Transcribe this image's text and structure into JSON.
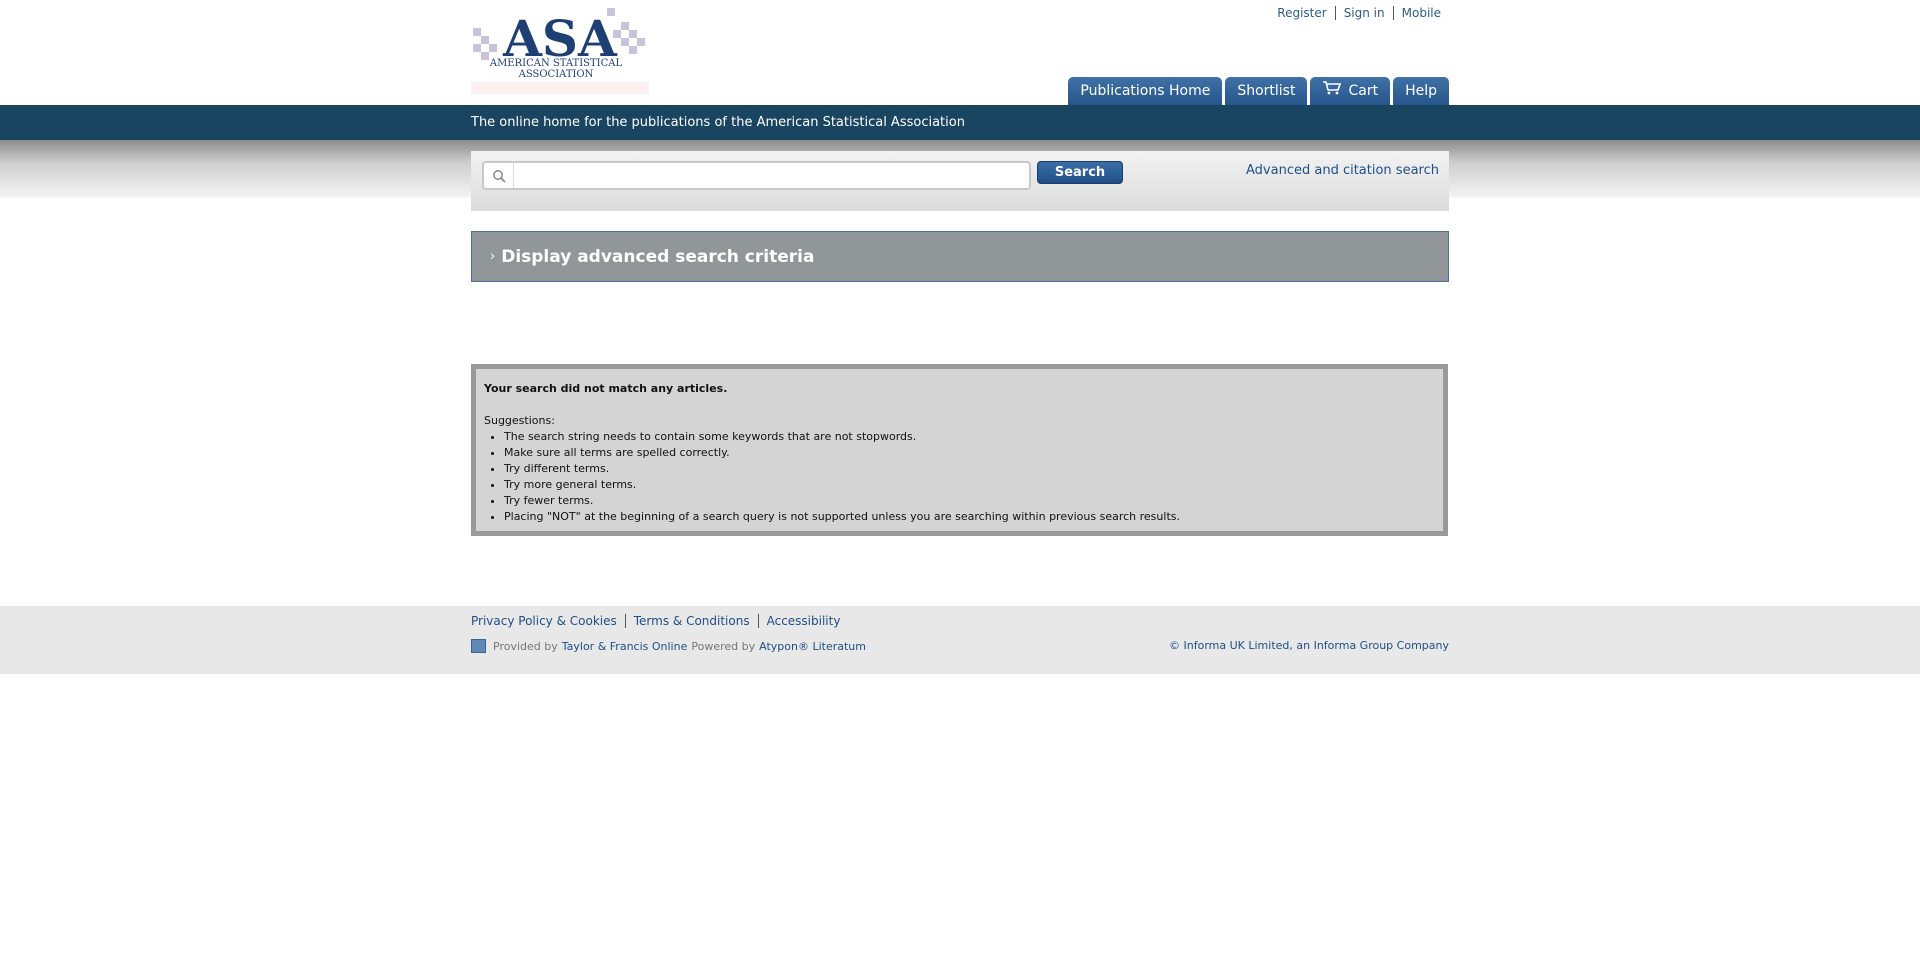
{
  "header": {
    "logo": {
      "letters": "ASA",
      "org_line1": "AMERICAN STATISTICAL",
      "org_line2": "ASSOCIATION"
    },
    "top_links": [
      "Register",
      "Sign in",
      "Mobile"
    ],
    "tabs": {
      "publications_home": "Publications Home",
      "shortlist": "Shortlist",
      "cart": "Cart",
      "help": "Help"
    },
    "tagline": "The online home for the publications of the American Statistical Association"
  },
  "search": {
    "input_value": "",
    "placeholder": "",
    "button_label": "Search",
    "advanced_link": "Advanced and citation search"
  },
  "advanced_criteria": {
    "toggle_label": "Display advanced search criteria"
  },
  "results": {
    "heading": "Your search did not match any articles.",
    "suggestions_label": "Suggestions:",
    "suggestions": [
      "The search string needs to contain some keywords that are not stopwords.",
      "Make sure all terms are spelled correctly.",
      "Try different terms.",
      "Try more general terms.",
      "Try fewer terms.",
      "Placing \"NOT\" at the beginning of a search query is not supported unless you are searching within previous search results."
    ]
  },
  "footer": {
    "links": [
      "Privacy Policy & Cookies",
      "Terms & Conditions",
      "Accessibility"
    ],
    "provided_by_label": "Provided by",
    "provided_by": "Taylor & Francis Online",
    "powered_by_label": "Powered by",
    "powered_by": "Atypon® Literatum",
    "copyright": "© Informa UK Limited, an Informa Group Company"
  },
  "colors": {
    "brand_navy": "#1a4560",
    "tab_blue": "#26568a",
    "link_blue": "#1f4f85"
  }
}
